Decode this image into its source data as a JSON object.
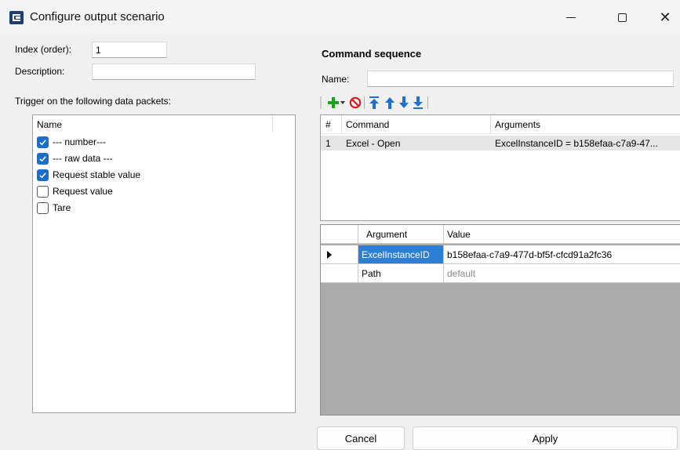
{
  "window": {
    "title": "Configure output scenario",
    "controls": {
      "minimize": "—",
      "maximize": "☐",
      "close": "✕"
    }
  },
  "form": {
    "index_label": "Index (order):",
    "index_value": "1",
    "description_label": "Description:",
    "description_value": "",
    "trigger_label": "Trigger on the following data packets:"
  },
  "trigger_list": {
    "header": "Name",
    "items": [
      {
        "label": "--- number---",
        "checked": true
      },
      {
        "label": "--- raw data ---",
        "checked": true
      },
      {
        "label": "Request stable value",
        "checked": true
      },
      {
        "label": "Request value",
        "checked": false
      },
      {
        "label": "Tare",
        "checked": false
      }
    ]
  },
  "command_sequence": {
    "title": "Command sequence",
    "name_label": "Name:",
    "name_value": "",
    "toolbar": [
      {
        "icon": "add-icon",
        "color": "#1aa31a"
      },
      {
        "icon": "delete-icon",
        "color": "#d81e1e"
      },
      {
        "icon": "move-top-icon",
        "color": "#1e6fd8"
      },
      {
        "icon": "move-up-icon",
        "color": "#1e6fd8"
      },
      {
        "icon": "move-down-icon",
        "color": "#1e6fd8"
      },
      {
        "icon": "move-bottom-icon",
        "color": "#1e6fd8"
      }
    ],
    "columns": [
      "#",
      "Command",
      "Arguments"
    ],
    "rows": [
      {
        "num": "1",
        "command": "Excel - Open",
        "arguments": "ExcelInstanceID = b158efaa-c7a9-47..."
      }
    ]
  },
  "arguments": {
    "columns": [
      "Argument",
      "Value"
    ],
    "rows": [
      {
        "argument": "ExcelInstanceID",
        "value": "b158efaa-c7a9-477d-bf5f-cfcd91a2fc36",
        "selected": true
      },
      {
        "argument": "Path",
        "value": "default",
        "selected": false
      }
    ]
  },
  "buttons": {
    "cancel": "Cancel",
    "apply": "Apply"
  },
  "colors": {
    "accent": "#1a6ec8",
    "selection": "#2c7fd5",
    "empty_grid": "#ababab"
  }
}
